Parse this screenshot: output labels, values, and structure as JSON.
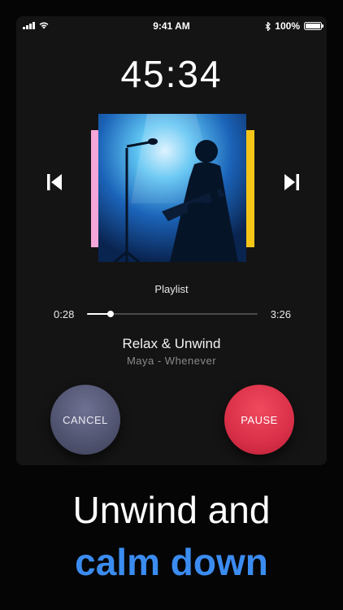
{
  "status_bar": {
    "time": "9:41 AM",
    "battery_text": "100%",
    "battery_level": 1.0
  },
  "timer": "45:34",
  "album_art": {
    "description_icon": "concert-guitarist-photo"
  },
  "player": {
    "playlist_label": "Playlist",
    "elapsed": "0:28",
    "total": "3:26",
    "progress": 0.136,
    "title": "Relax & Unwind",
    "subtitle": "Maya - Whenever"
  },
  "buttons": {
    "cancel_label": "CANCEL",
    "pause_label": "PAUSE"
  },
  "headline": {
    "line1": "Unwind and",
    "line2": "calm down"
  },
  "colors": {
    "accent_blue": "#3b8cf0",
    "cancel_button": "#585b78",
    "pause_button": "#d9304a",
    "stripe_pink": "#f4a6d8",
    "stripe_yellow": "#f5c518"
  }
}
